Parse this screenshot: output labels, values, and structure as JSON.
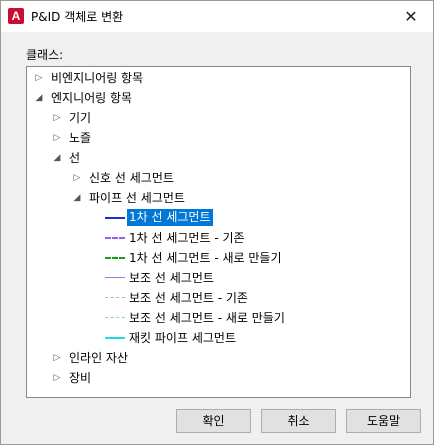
{
  "window": {
    "title": "P&ID 객체로 변환",
    "icon_letter": "A",
    "close_glyph": "✕"
  },
  "class_label": "클래스:",
  "tree": {
    "nodes": [
      {
        "label": "비엔지니어링 항목",
        "toggle": "collapsed"
      },
      {
        "label": "엔지니어링 항목",
        "toggle": "expanded"
      },
      {
        "label": "기기",
        "toggle": "collapsed"
      },
      {
        "label": "노즐",
        "toggle": "collapsed"
      },
      {
        "label": "선",
        "toggle": "expanded"
      },
      {
        "label": "신호 선 세그먼트",
        "toggle": "collapsed"
      },
      {
        "label": "파이프 선 세그먼트",
        "toggle": "expanded"
      },
      {
        "label": "1차 선 세그먼트",
        "selected": true,
        "swatch_color": "#1f2bd6",
        "swatch_style": "solid"
      },
      {
        "label": "1차 선 세그먼트 - 기존",
        "swatch_color": "#9a5cf0",
        "swatch_style": "dashed"
      },
      {
        "label": "1차 선 세그먼트 - 새로 만들기",
        "swatch_color": "#16a016",
        "swatch_style": "dashed"
      },
      {
        "label": "보조 선 세그먼트",
        "swatch_color": "#8a84e0",
        "swatch_style": "solid"
      },
      {
        "label": "보조 선 세그먼트 - 기존",
        "swatch_color": "#b0b0dd",
        "swatch_style": "dashed"
      },
      {
        "label": "보조 선 세그먼트 - 새로 만들기",
        "swatch_color": "#8fdc8f",
        "swatch_style": "dashed"
      },
      {
        "label": "재킷 파이프 세그먼트",
        "swatch_color": "#20d9e6",
        "swatch_style": "solid"
      },
      {
        "label": "인라인 자산",
        "toggle": "collapsed"
      },
      {
        "label": "장비",
        "toggle": "collapsed"
      }
    ]
  },
  "buttons": {
    "ok": "확인",
    "cancel": "취소",
    "help": "도움말"
  }
}
